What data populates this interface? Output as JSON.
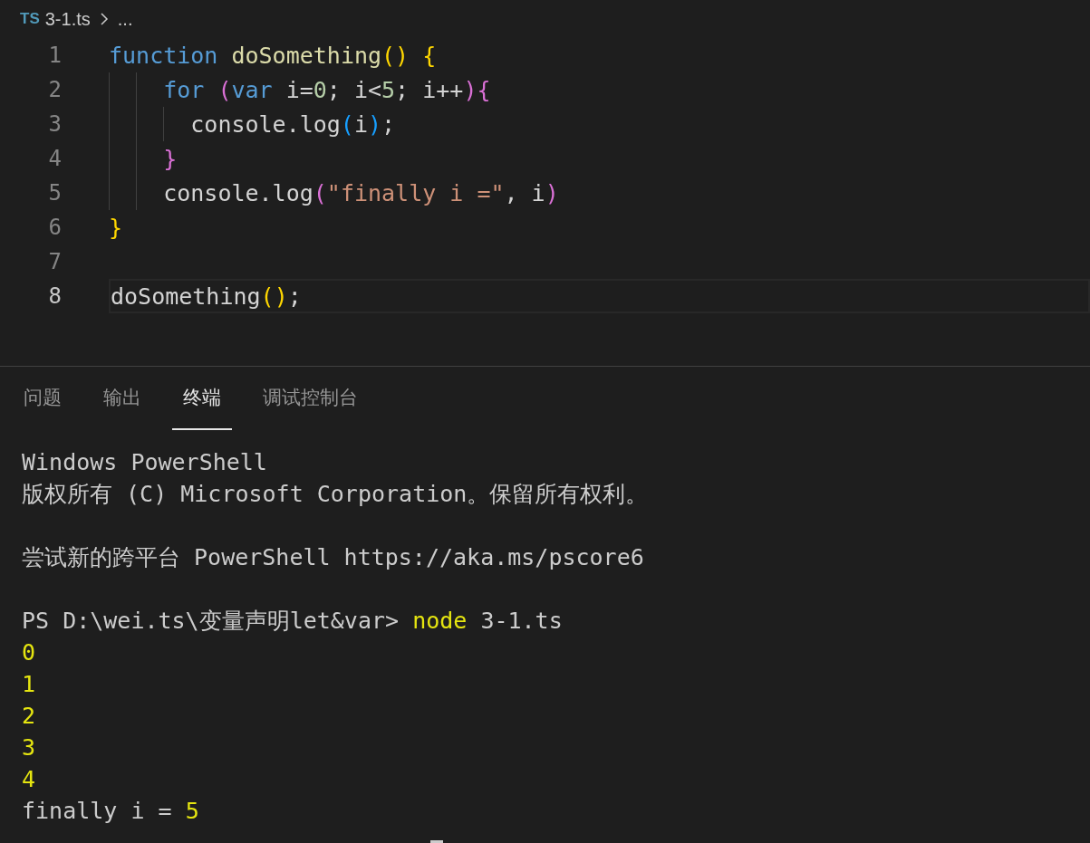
{
  "breadcrumb": {
    "file_icon_text": "TS",
    "file": "3-1.ts",
    "rest": "..."
  },
  "editor": {
    "lines": [
      {
        "number": "1",
        "current": false,
        "tokens": [
          {
            "kind": "keyword",
            "text": "function"
          },
          {
            "kind": "function",
            "text": "doSomething",
            "space_before": true
          },
          {
            "kind": "paren1",
            "text": "()"
          },
          {
            "kind": "paren1",
            "text": "{",
            "space_before": true
          }
        ]
      },
      {
        "number": "2",
        "current": false,
        "tokens": [
          {
            "kind": "guide"
          },
          {
            "kind": "guide"
          },
          {
            "kind": "keyword",
            "text": "for"
          },
          {
            "kind": "paren2",
            "text": "(",
            "space_before": true
          },
          {
            "kind": "keyword",
            "text": "var"
          },
          {
            "kind": "plain",
            "text": " i="
          },
          {
            "kind": "number",
            "text": "0"
          },
          {
            "kind": "plain",
            "text": "; i<"
          },
          {
            "kind": "number",
            "text": "5"
          },
          {
            "kind": "plain",
            "text": "; i++"
          },
          {
            "kind": "paren2",
            "text": "){"
          }
        ]
      },
      {
        "number": "3",
        "current": false,
        "tokens": [
          {
            "kind": "guide"
          },
          {
            "kind": "guide"
          },
          {
            "kind": "guide"
          },
          {
            "kind": "plain",
            "text": "console.log"
          },
          {
            "kind": "paren3",
            "text": "("
          },
          {
            "kind": "plain",
            "text": "i"
          },
          {
            "kind": "paren3",
            "text": ")"
          },
          {
            "kind": "plain",
            "text": ";"
          }
        ]
      },
      {
        "number": "4",
        "current": false,
        "tokens": [
          {
            "kind": "guide"
          },
          {
            "kind": "guide"
          },
          {
            "kind": "paren2",
            "text": "}"
          }
        ]
      },
      {
        "number": "5",
        "current": false,
        "tokens": [
          {
            "kind": "guide"
          },
          {
            "kind": "guide"
          },
          {
            "kind": "plain",
            "text": "console.log"
          },
          {
            "kind": "paren2",
            "text": "("
          },
          {
            "kind": "string",
            "text": "\"finally i =\""
          },
          {
            "kind": "plain",
            "text": ", i"
          },
          {
            "kind": "paren2",
            "text": ")"
          }
        ]
      },
      {
        "number": "6",
        "current": false,
        "tokens": [
          {
            "kind": "paren1",
            "text": "}"
          }
        ]
      },
      {
        "number": "7",
        "current": false
      },
      {
        "number": "8",
        "current": true,
        "tokens": [
          {
            "kind": "plain",
            "text": "doSomething"
          },
          {
            "kind": "paren1",
            "text": "()"
          },
          {
            "kind": "plain",
            "text": ";"
          }
        ]
      }
    ]
  },
  "panel": {
    "tabs": [
      {
        "label": "问题",
        "selected": false
      },
      {
        "label": "输出",
        "selected": false
      },
      {
        "label": "终端",
        "selected": true
      },
      {
        "label": "调试控制台",
        "selected": false
      }
    ],
    "terminal": [
      {
        "kind": "text",
        "segments": [
          {
            "text": "Windows PowerShell",
            "highlight": false
          }
        ]
      },
      {
        "kind": "text",
        "segments": [
          {
            "text": "版权所有 (C) Microsoft Corporation。保留所有权利。",
            "highlight": false
          }
        ]
      },
      {
        "kind": "blank"
      },
      {
        "kind": "text",
        "segments": [
          {
            "text": "尝试新的跨平台 PowerShell https://aka.ms/pscore6",
            "highlight": false
          }
        ]
      },
      {
        "kind": "blank"
      },
      {
        "kind": "text",
        "segments": [
          {
            "text": "PS D:\\wei.ts\\变量声明let&var> ",
            "highlight": false
          },
          {
            "text": "node",
            "highlight": true
          },
          {
            "text": " 3-1.ts",
            "highlight": false
          }
        ]
      },
      {
        "kind": "text",
        "segments": [
          {
            "text": "0",
            "highlight": true
          }
        ]
      },
      {
        "kind": "text",
        "segments": [
          {
            "text": "1",
            "highlight": true
          }
        ]
      },
      {
        "kind": "text",
        "segments": [
          {
            "text": "2",
            "highlight": true
          }
        ]
      },
      {
        "kind": "text",
        "segments": [
          {
            "text": "3",
            "highlight": true
          }
        ]
      },
      {
        "kind": "text",
        "segments": [
          {
            "text": "4",
            "highlight": true
          }
        ]
      },
      {
        "kind": "text",
        "segments": [
          {
            "text": "finally i = ",
            "highlight": false
          },
          {
            "text": "5",
            "highlight": true
          }
        ]
      }
    ]
  }
}
